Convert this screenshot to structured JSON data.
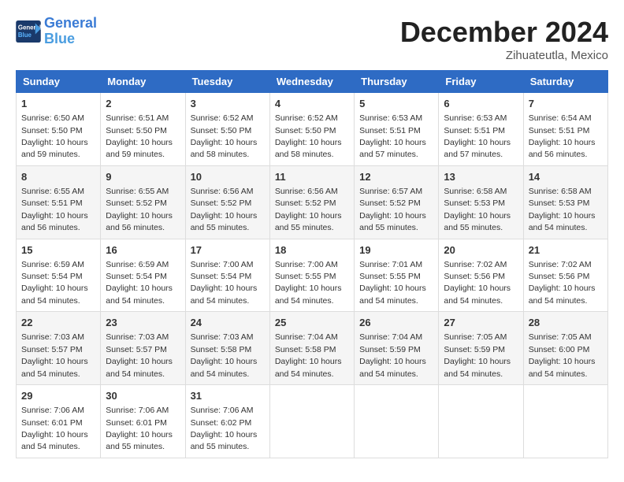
{
  "header": {
    "logo_line1": "General",
    "logo_line2": "Blue",
    "month_title": "December 2024",
    "location": "Zihuateutla, Mexico"
  },
  "weekdays": [
    "Sunday",
    "Monday",
    "Tuesday",
    "Wednesday",
    "Thursday",
    "Friday",
    "Saturday"
  ],
  "weeks": [
    [
      {
        "day": "1",
        "sunrise": "6:50 AM",
        "sunset": "5:50 PM",
        "daylight": "10 hours and 59 minutes."
      },
      {
        "day": "2",
        "sunrise": "6:51 AM",
        "sunset": "5:50 PM",
        "daylight": "10 hours and 59 minutes."
      },
      {
        "day": "3",
        "sunrise": "6:52 AM",
        "sunset": "5:50 PM",
        "daylight": "10 hours and 58 minutes."
      },
      {
        "day": "4",
        "sunrise": "6:52 AM",
        "sunset": "5:50 PM",
        "daylight": "10 hours and 58 minutes."
      },
      {
        "day": "5",
        "sunrise": "6:53 AM",
        "sunset": "5:51 PM",
        "daylight": "10 hours and 57 minutes."
      },
      {
        "day": "6",
        "sunrise": "6:53 AM",
        "sunset": "5:51 PM",
        "daylight": "10 hours and 57 minutes."
      },
      {
        "day": "7",
        "sunrise": "6:54 AM",
        "sunset": "5:51 PM",
        "daylight": "10 hours and 56 minutes."
      }
    ],
    [
      {
        "day": "8",
        "sunrise": "6:55 AM",
        "sunset": "5:51 PM",
        "daylight": "10 hours and 56 minutes."
      },
      {
        "day": "9",
        "sunrise": "6:55 AM",
        "sunset": "5:52 PM",
        "daylight": "10 hours and 56 minutes."
      },
      {
        "day": "10",
        "sunrise": "6:56 AM",
        "sunset": "5:52 PM",
        "daylight": "10 hours and 55 minutes."
      },
      {
        "day": "11",
        "sunrise": "6:56 AM",
        "sunset": "5:52 PM",
        "daylight": "10 hours and 55 minutes."
      },
      {
        "day": "12",
        "sunrise": "6:57 AM",
        "sunset": "5:52 PM",
        "daylight": "10 hours and 55 minutes."
      },
      {
        "day": "13",
        "sunrise": "6:58 AM",
        "sunset": "5:53 PM",
        "daylight": "10 hours and 55 minutes."
      },
      {
        "day": "14",
        "sunrise": "6:58 AM",
        "sunset": "5:53 PM",
        "daylight": "10 hours and 54 minutes."
      }
    ],
    [
      {
        "day": "15",
        "sunrise": "6:59 AM",
        "sunset": "5:54 PM",
        "daylight": "10 hours and 54 minutes."
      },
      {
        "day": "16",
        "sunrise": "6:59 AM",
        "sunset": "5:54 PM",
        "daylight": "10 hours and 54 minutes."
      },
      {
        "day": "17",
        "sunrise": "7:00 AM",
        "sunset": "5:54 PM",
        "daylight": "10 hours and 54 minutes."
      },
      {
        "day": "18",
        "sunrise": "7:00 AM",
        "sunset": "5:55 PM",
        "daylight": "10 hours and 54 minutes."
      },
      {
        "day": "19",
        "sunrise": "7:01 AM",
        "sunset": "5:55 PM",
        "daylight": "10 hours and 54 minutes."
      },
      {
        "day": "20",
        "sunrise": "7:02 AM",
        "sunset": "5:56 PM",
        "daylight": "10 hours and 54 minutes."
      },
      {
        "day": "21",
        "sunrise": "7:02 AM",
        "sunset": "5:56 PM",
        "daylight": "10 hours and 54 minutes."
      }
    ],
    [
      {
        "day": "22",
        "sunrise": "7:03 AM",
        "sunset": "5:57 PM",
        "daylight": "10 hours and 54 minutes."
      },
      {
        "day": "23",
        "sunrise": "7:03 AM",
        "sunset": "5:57 PM",
        "daylight": "10 hours and 54 minutes."
      },
      {
        "day": "24",
        "sunrise": "7:03 AM",
        "sunset": "5:58 PM",
        "daylight": "10 hours and 54 minutes."
      },
      {
        "day": "25",
        "sunrise": "7:04 AM",
        "sunset": "5:58 PM",
        "daylight": "10 hours and 54 minutes."
      },
      {
        "day": "26",
        "sunrise": "7:04 AM",
        "sunset": "5:59 PM",
        "daylight": "10 hours and 54 minutes."
      },
      {
        "day": "27",
        "sunrise": "7:05 AM",
        "sunset": "5:59 PM",
        "daylight": "10 hours and 54 minutes."
      },
      {
        "day": "28",
        "sunrise": "7:05 AM",
        "sunset": "6:00 PM",
        "daylight": "10 hours and 54 minutes."
      }
    ],
    [
      {
        "day": "29",
        "sunrise": "7:06 AM",
        "sunset": "6:01 PM",
        "daylight": "10 hours and 54 minutes."
      },
      {
        "day": "30",
        "sunrise": "7:06 AM",
        "sunset": "6:01 PM",
        "daylight": "10 hours and 55 minutes."
      },
      {
        "day": "31",
        "sunrise": "7:06 AM",
        "sunset": "6:02 PM",
        "daylight": "10 hours and 55 minutes."
      },
      null,
      null,
      null,
      null
    ]
  ]
}
